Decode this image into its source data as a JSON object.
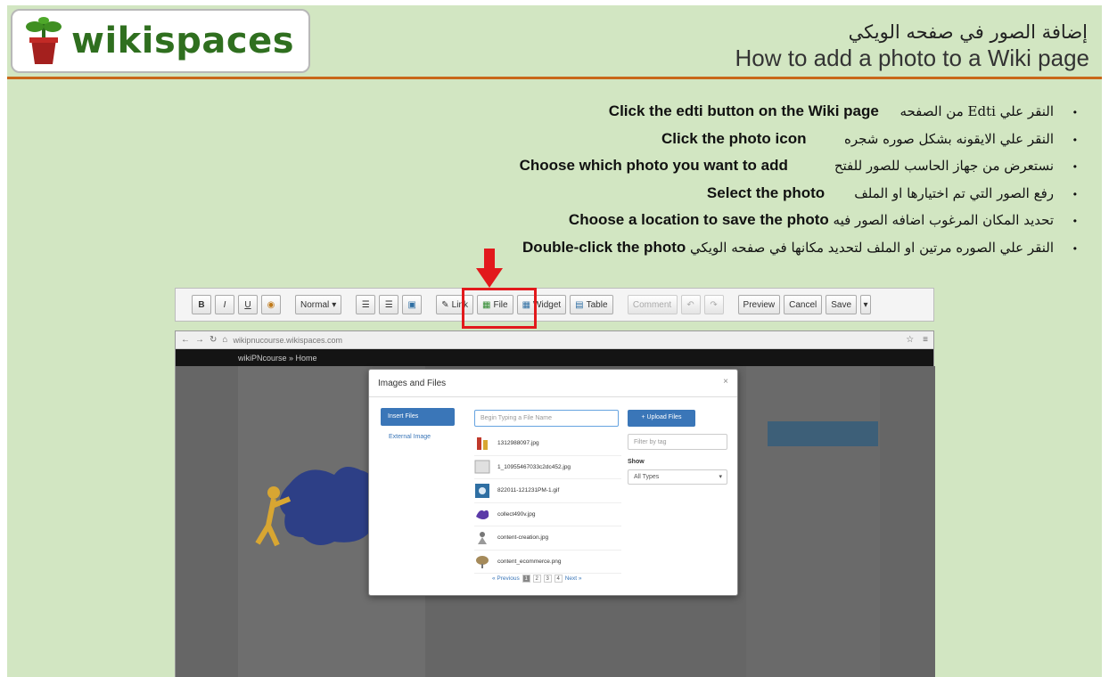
{
  "header": {
    "logo_text": "wikispaces",
    "title_ar": "إضافة الصور في صفحه الويكي",
    "title_en": "How to add a photo to a Wiki page"
  },
  "steps": [
    {
      "ar": "النقر علي Edti من الصفحه",
      "en": "Click the edti button on the Wiki page"
    },
    {
      "ar": "النقر علي الايقونه بشكل صوره شجره",
      "en": "Click the photo icon"
    },
    {
      "ar": "نستعرض من جهاز الحاسب للصور للفتح",
      "en": "Choose which photo you want to add"
    },
    {
      "ar": "رفع الصور التي تم اختيارها او الملف",
      "en": "Select the photo"
    },
    {
      "ar": "تحديد المكان المرغوب اضافه الصور فيه",
      "en": "Choose a location to save the photo"
    },
    {
      "ar": "النقر علي الصوره مرتين او الملف لتحديد مكانها في صفحه الويكي",
      "en": "Double-click the photo"
    }
  ],
  "toolbar": {
    "bold": "B",
    "italic": "I",
    "underline": "U",
    "format_select": "Normal",
    "link": "Link",
    "file": "File",
    "widget": "Widget",
    "table": "Table",
    "comment": "Comment",
    "preview": "Preview",
    "cancel": "Cancel",
    "save": "Save"
  },
  "browser": {
    "url": "wikipnucourse.wikispaces.com",
    "nav_title": "wikiPNcourse » Home"
  },
  "modal": {
    "title": "Images and Files",
    "close": "×",
    "tab_insert": "Insert Files",
    "tab_external": "External Image",
    "search_placeholder": "Begin Typing a File Name",
    "upload_label": "+ Upload Files",
    "filter_placeholder": "Filter by tag",
    "show_label": "Show",
    "types_value": "All Types",
    "files": [
      {
        "name": "1312988097.jpg",
        "thumb": "#c0392b"
      },
      {
        "name": "1_10955467033c2dc452.jpg",
        "thumb": "#bdbdbd"
      },
      {
        "name": "822011-121231PM-1.gif",
        "thumb": "#2f6fa3"
      },
      {
        "name": "collect490v.jpg",
        "thumb": "#5b3aa8"
      },
      {
        "name": "content-creation.jpg",
        "thumb": "#9a9a9a"
      },
      {
        "name": "content_ecommerce.png",
        "thumb": "#a58a5a"
      }
    ],
    "pager": {
      "prev": "« Previous",
      "pages": [
        "1",
        "2",
        "3",
        "4"
      ],
      "current": "1",
      "next": "Next »"
    }
  },
  "colors": {
    "accent_red": "#e2191c",
    "slide_bg": "#d2e6c2",
    "header_rule": "#c9671a",
    "logo_green": "#2f6f1f"
  }
}
